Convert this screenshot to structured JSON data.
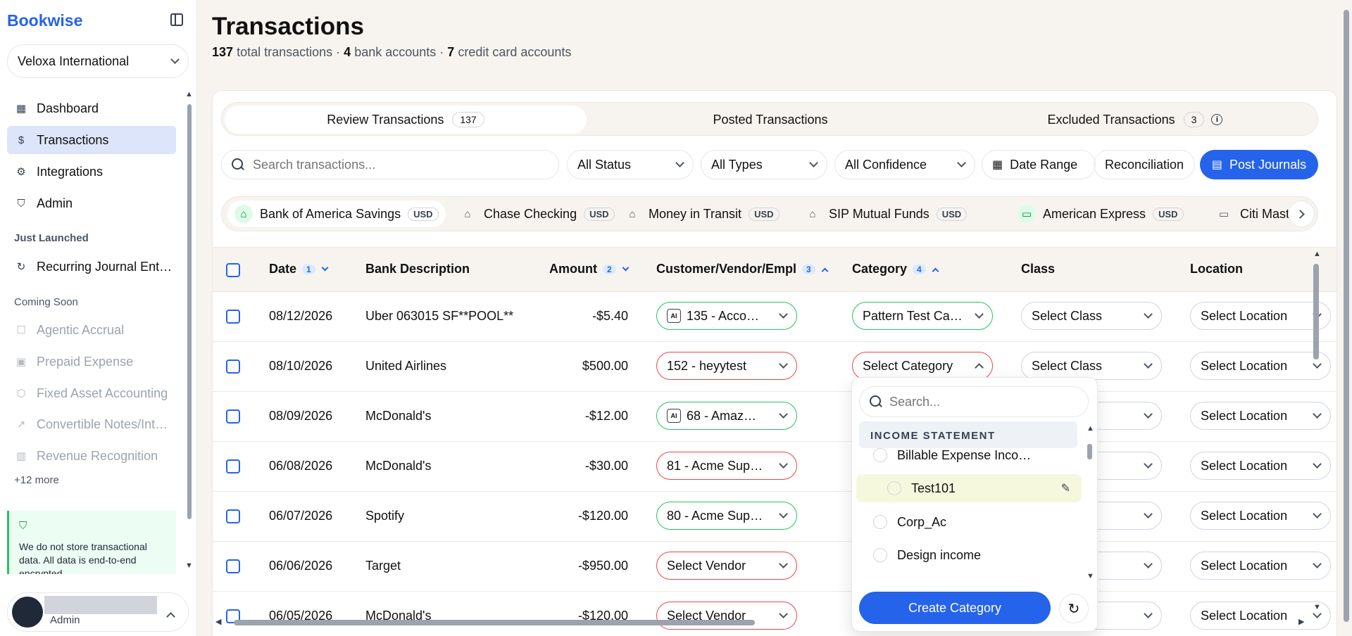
{
  "app": {
    "name": "Bookwise"
  },
  "sidebar": {
    "org": "Veloxa International",
    "nav": [
      {
        "label": "Dashboard",
        "icon": "grid-icon"
      },
      {
        "label": "Transactions",
        "icon": "dollar-doc-icon"
      },
      {
        "label": "Integrations",
        "icon": "gear-icon"
      },
      {
        "label": "Admin",
        "icon": "shield-icon"
      }
    ],
    "just_launched_label": "Just Launched",
    "just_launched": [
      {
        "label": "Recurring Journal Ent…",
        "icon": "refresh-icon"
      }
    ],
    "coming_soon_label": "Coming Soon",
    "coming_soon": [
      {
        "label": "Agentic Accrual",
        "icon": "robot-icon"
      },
      {
        "label": "Prepaid Expense",
        "icon": "calendar-icon"
      },
      {
        "label": "Fixed Asset Accounting",
        "icon": "box-icon"
      },
      {
        "label": "Convertible Notes/Int…",
        "icon": "trend-icon"
      },
      {
        "label": "Revenue Recognition",
        "icon": "bar-chart-icon"
      }
    ],
    "more": "+12 more",
    "notice": "We do not store transactional data. All data is end-to-end encrypted.",
    "user_role": "Admin"
  },
  "header": {
    "title": "Transactions",
    "total_count": "137",
    "total_text": "total transactions ·",
    "bank_count": "4",
    "bank_text": "bank accounts ·",
    "cc_count": "7",
    "cc_text": "credit card accounts"
  },
  "tabs": [
    {
      "label": "Review Transactions",
      "count": "137"
    },
    {
      "label": "Posted Transactions"
    },
    {
      "label": "Excluded Transactions",
      "count": "3"
    }
  ],
  "filters": {
    "search_placeholder": "Search transactions...",
    "status": "All Status",
    "types": "All Types",
    "confidence": "All Confidence",
    "date_range": "Date Range",
    "reconciliation": "Reconciliation",
    "post_journals": "Post Journals"
  },
  "banks": [
    {
      "name": "Bank of America Savings",
      "currency": "USD"
    },
    {
      "name": "Chase Checking",
      "currency": "USD"
    },
    {
      "name": "Money in Transit",
      "currency": "USD"
    },
    {
      "name": "SIP Mutual Funds",
      "currency": "USD"
    },
    {
      "name": "American Express",
      "currency": "USD"
    },
    {
      "name": "Citi Master"
    }
  ],
  "table": {
    "headers": {
      "date": "Date",
      "date_num": "1",
      "desc": "Bank Description",
      "amount": "Amount",
      "amount_num": "2",
      "vendor": "Customer/Vendor/Empl",
      "vendor_num": "3",
      "category": "Category",
      "category_num": "4",
      "class": "Class",
      "location": "Location"
    },
    "rows": [
      {
        "date": "08/12/2026",
        "desc": "Uber 063015 SF**POOL**",
        "amount": "-$5.40",
        "vendor": "135 - Acco…",
        "category": "Pattern Test Ca…",
        "class": "Select Class",
        "location": "Select Location"
      },
      {
        "date": "08/10/2026",
        "desc": "United Airlines",
        "amount": "$500.00",
        "vendor": "152 - heyytest",
        "category": "Select Category",
        "class": "Select Class",
        "location": "Select Location"
      },
      {
        "date": "08/09/2026",
        "desc": "McDonald's",
        "amount": "-$12.00",
        "vendor": "68 - Amaz…",
        "location": "Select Location"
      },
      {
        "date": "06/08/2026",
        "desc": "McDonald's",
        "amount": "-$30.00",
        "vendor": "81 - Acme Sup…",
        "location": "Select Location"
      },
      {
        "date": "06/07/2026",
        "desc": "Spotify",
        "amount": "-$120.00",
        "vendor": "80 - Acme Sup…",
        "location": "Select Location"
      },
      {
        "date": "06/06/2026",
        "desc": "Target",
        "amount": "-$950.00",
        "vendor": "Select Vendor",
        "location": "Select Location"
      },
      {
        "date": "06/05/2026",
        "desc": "McDonald's",
        "amount": "-$120.00",
        "vendor": "Select Vendor",
        "location": "Select Location"
      }
    ]
  },
  "category_dropdown": {
    "search_placeholder": "Search...",
    "group": "INCOME STATEMENT",
    "items": [
      "Billable Expense Inco…",
      "Test101",
      "Corp_Ac",
      "Design income"
    ],
    "create_label": "Create Category"
  },
  "colors": {
    "accent": "#2563eb",
    "valid": "#22c55e",
    "invalid": "#ef4444"
  }
}
